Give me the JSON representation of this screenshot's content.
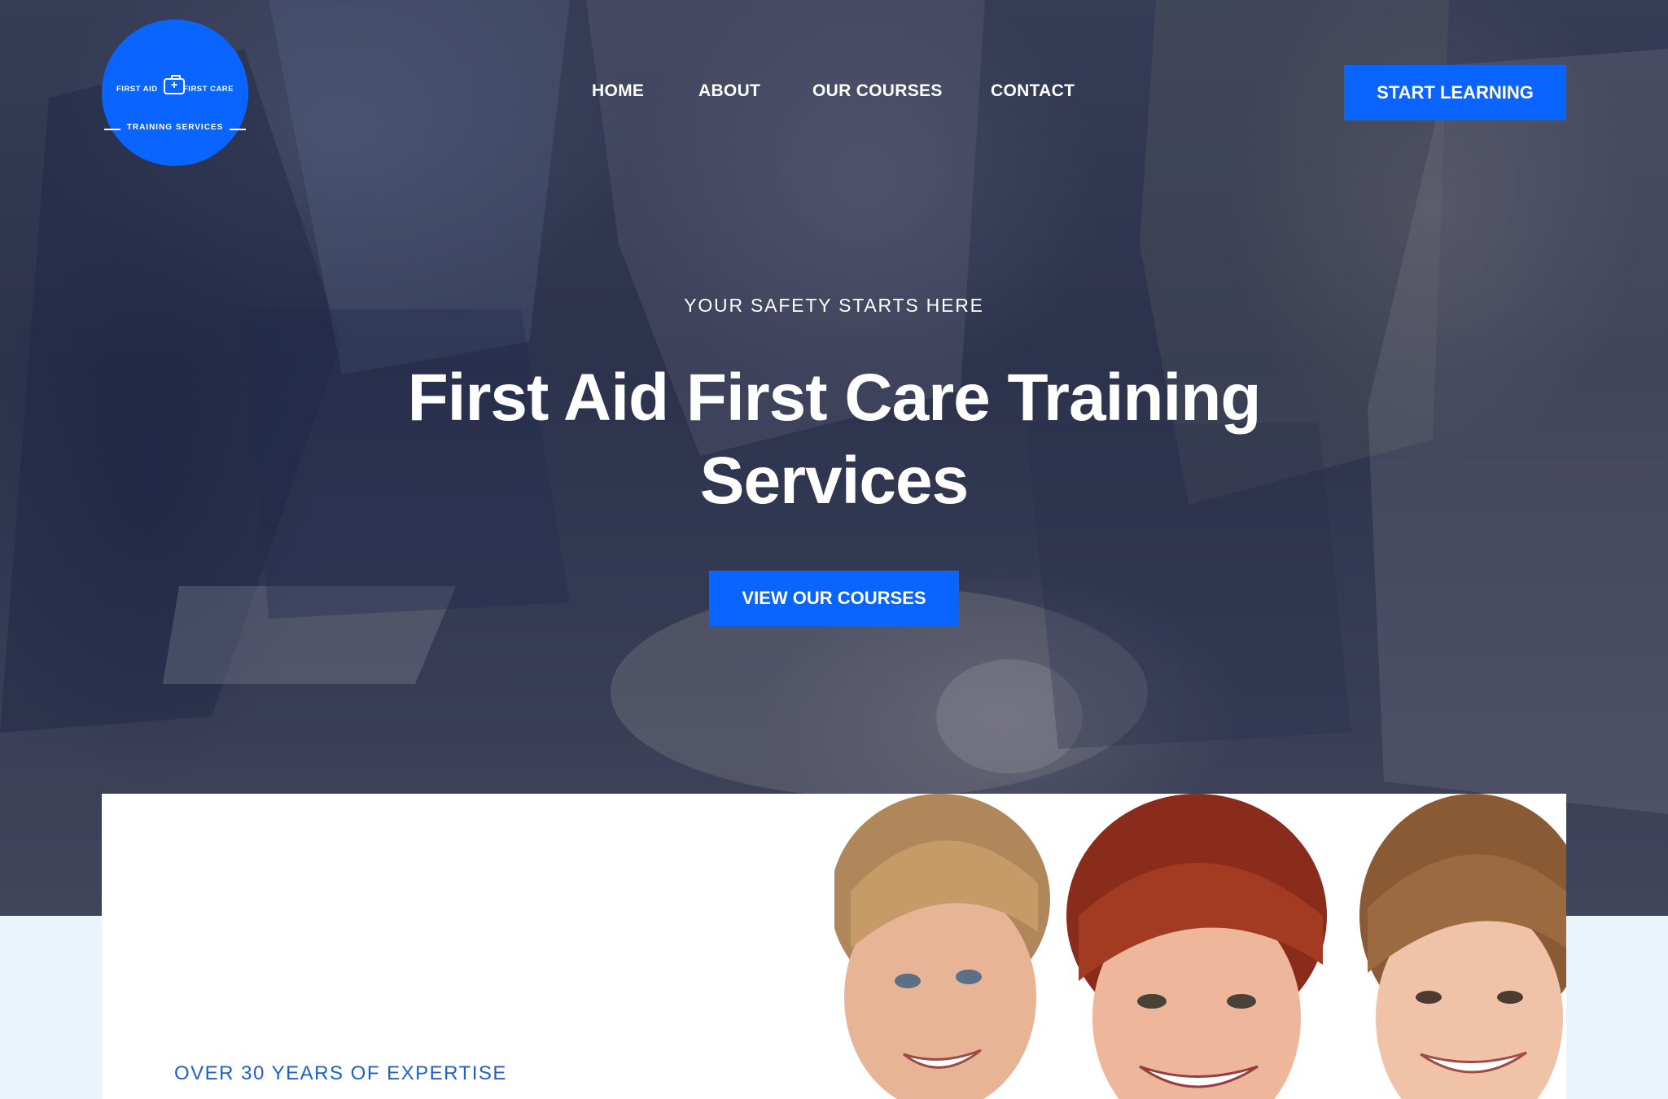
{
  "logo": {
    "left_text": "FIRST AID",
    "right_text": "FIRST CARE",
    "bottom_text": "TRAINING SERVICES",
    "icon": "first-aid-kit-icon"
  },
  "nav": {
    "items": [
      "HOME",
      "ABOUT",
      "OUR COURSES",
      "CONTACT"
    ],
    "cta": "START LEARNING"
  },
  "hero": {
    "eyebrow": "YOUR SAFETY STARTS HERE",
    "title": "First Aid First Care Training Services",
    "cta": "VIEW OUR COURSES"
  },
  "about": {
    "eyebrow": "OVER 30 YEARS OF EXPERTISE"
  },
  "colors": {
    "accent": "#0a64ff",
    "eyebrow_blue": "#1d5fd0",
    "section_bg": "#eaf4fc"
  }
}
